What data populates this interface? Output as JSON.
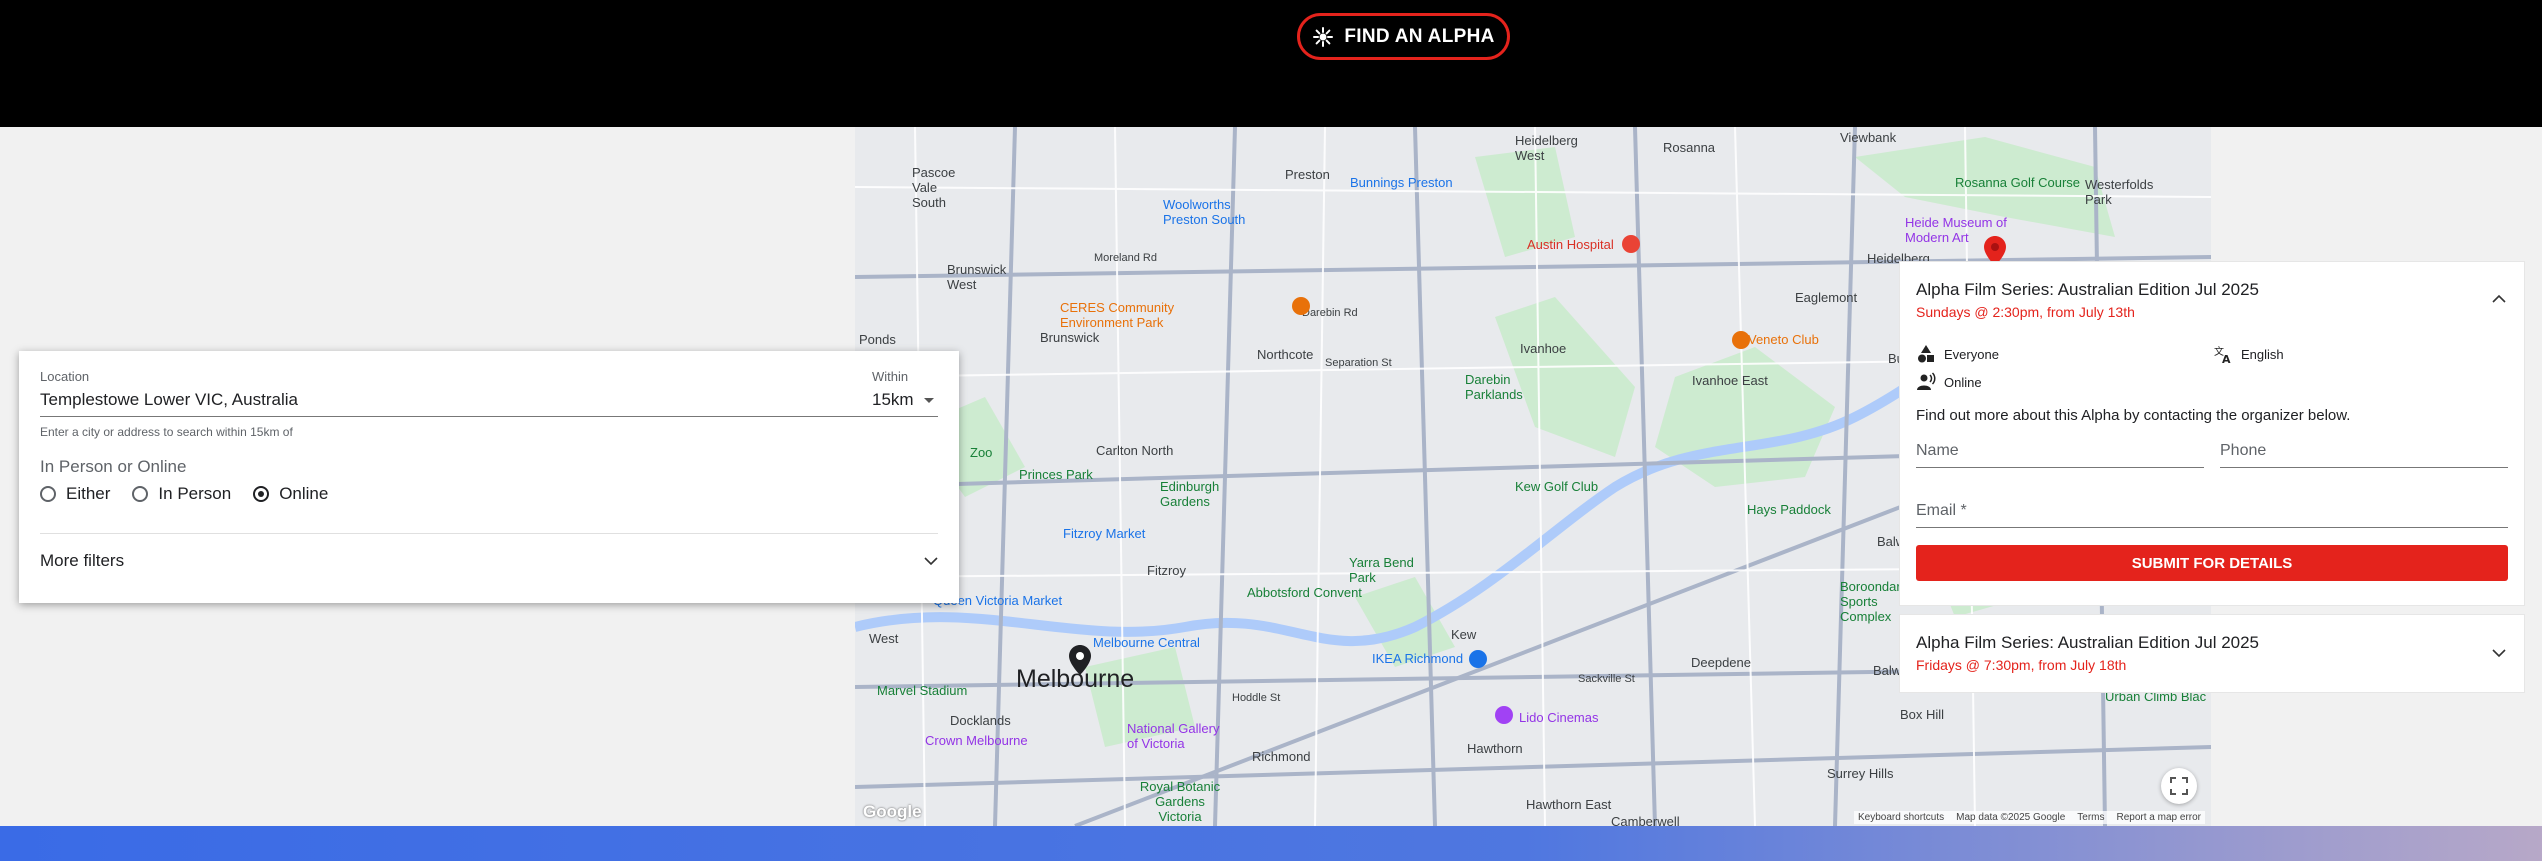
{
  "header": {
    "find_label": "FIND AN ALPHA"
  },
  "filters": {
    "location_label": "Location",
    "location_value": "Templestowe Lower VIC, Australia",
    "within_label": "Within",
    "within_value": "15km",
    "help_text": "Enter a city or address to search within 15km of",
    "mode_title": "In Person or Online",
    "modes": [
      {
        "label": "Either",
        "selected": false
      },
      {
        "label": "In Person",
        "selected": false
      },
      {
        "label": "Online",
        "selected": true
      }
    ],
    "more_filters": "More filters"
  },
  "map": {
    "labels": [
      "Preston",
      "Heidelberg West",
      "Rosanna",
      "Viewbank",
      "Pascoe Vale South",
      "Bunnings Preston",
      "Woolworths Preston South",
      "Rosanna Golf Course",
      "Heide Museum of Modern Art",
      "Westerfolds Park",
      "Austin Hospital",
      "Heidelberg",
      "Brunswick West",
      "Moreland Rd",
      "CERES Community Environment Park",
      "Darebin Rd",
      "Eaglemont",
      "Brunswick",
      "Northcote",
      "Ivanhoe",
      "Veneto Club",
      "Bulleen",
      "Ponds",
      "Separation St",
      "Darebin Parklands",
      "Ivanhoe East",
      "Carlton North",
      "Zoo",
      "Princes Park",
      "Edinburgh Gardens",
      "Kew Golf Club",
      "Hays Paddock",
      "Fitzroy Market",
      "Yarra Bend Park",
      "Balwyn North",
      "Fitzroy",
      "Abbotsford Convent",
      "Boroondara Sports Complex",
      "Queen Victoria Market",
      "Kew",
      "West",
      "Melbourne Central",
      "IKEA Richmond",
      "Deepdene",
      "Balwyn",
      "Marvel Stadium",
      "Melbourne",
      "Docklands",
      "Hoddle St",
      "Sackville St",
      "Lido Cinemas",
      "Box Hill",
      "Crown Melbourne",
      "National Gallery of Victoria",
      "Hawthorn",
      "Richmond",
      "Surrey Hills",
      "Royal Botanic Gardens Victoria",
      "Hawthorn East",
      "Camberwell",
      "Urban Climb Blac"
    ],
    "google": "Google",
    "attribution": [
      "Keyboard shortcuts",
      "Map data ©2025 Google",
      "Terms",
      "Report a map error"
    ]
  },
  "events": [
    {
      "title": "Alpha Film Series: Australian Edition Jul 2025",
      "schedule": "Sundays @ 2:30pm, from July 13th",
      "tags": {
        "audience": "Everyone",
        "language": "English",
        "format": "Online"
      },
      "info": "Find out more about this Alpha by contacting the organizer below.",
      "name_label": "Name",
      "phone_label": "Phone",
      "email_label": "Email *",
      "submit_label": "SUBMIT FOR DETAILS"
    },
    {
      "title": "Alpha Film Series: Australian Edition Jul 2025",
      "schedule": "Fridays @ 7:30pm, from July 18th"
    }
  ],
  "colors": {
    "accent": "#e4231c",
    "header_bg": "#000000",
    "footer_gradient_start": "#3a6be6"
  }
}
